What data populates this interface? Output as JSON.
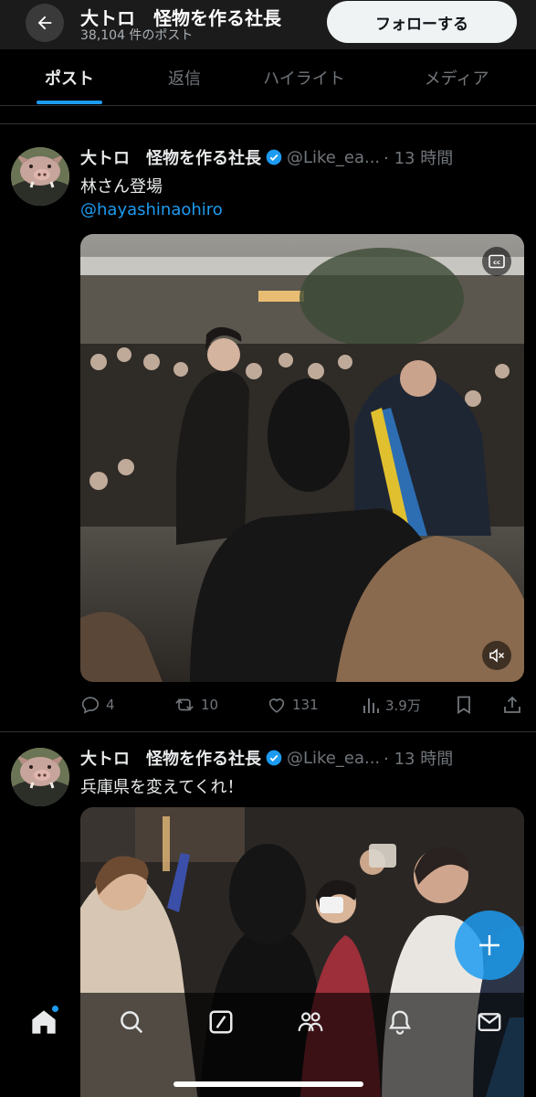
{
  "header": {
    "name": "大トロ　怪物を作る社長",
    "post_count": "38,104 件のポスト",
    "follow_label": "フォローする"
  },
  "tabs": [
    {
      "label": "ポスト",
      "active": true
    },
    {
      "label": "返信",
      "active": false
    },
    {
      "label": "ハイライト",
      "active": false
    },
    {
      "label": "メディア",
      "active": false
    }
  ],
  "tweets": [
    {
      "name": "大トロ　怪物を作る社長",
      "handle": "@Like_ea...",
      "time": "· 13 時間",
      "text": "林さん登場",
      "mention": "@hayashinaohiro",
      "media_type": "video",
      "replies": "4",
      "reposts": "10",
      "likes": "131",
      "views": "3.9万"
    },
    {
      "name": "大トロ　怪物を作る社長",
      "handle": "@Like_ea...",
      "time": "· 13 時間",
      "text": "兵庫県を変えてくれ！",
      "media_type": "video"
    }
  ],
  "icons": {
    "back": "back-arrow-icon",
    "verified": "verified-badge-icon",
    "reply": "reply-icon",
    "repost": "repost-icon",
    "like": "like-icon",
    "views": "views-icon",
    "bookmark": "bookmark-icon",
    "share": "share-icon",
    "captions": "captions-icon",
    "mute": "mute-icon",
    "compose": "compose-plus-icon",
    "nav": [
      "home-icon",
      "search-icon",
      "grok-icon",
      "communities-icon",
      "notifications-icon",
      "messages-icon"
    ]
  },
  "colors": {
    "accent": "#1d9bf0",
    "background": "#000000",
    "text": "#e7e9ea",
    "muted": "#71767b"
  }
}
